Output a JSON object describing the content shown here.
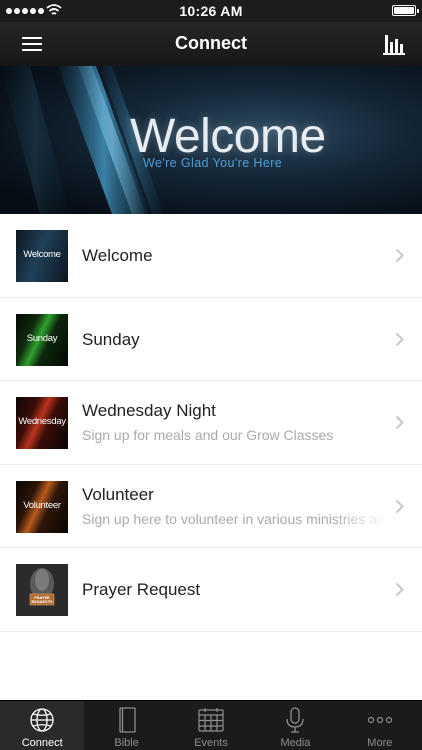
{
  "status_bar": {
    "time": "10:26 AM"
  },
  "nav": {
    "title": "Connect"
  },
  "banner": {
    "title": "Welcome",
    "subtitle": "We're Glad You're Here"
  },
  "items": [
    {
      "thumb_text": "Welcome",
      "title": "Welcome",
      "subtitle": ""
    },
    {
      "thumb_text": "Sunday",
      "title": "Sunday",
      "subtitle": ""
    },
    {
      "thumb_text": "Wednesday",
      "title": "Wednesday Night",
      "subtitle": "Sign up for meals and our Grow Classes"
    },
    {
      "thumb_text": "Volunteer",
      "title": "Volunteer",
      "subtitle": "Sign up here to volunteer in various ministries around"
    },
    {
      "thumb_text": "PRAYER REQUESTS",
      "title": "Prayer Request",
      "subtitle": ""
    }
  ],
  "tabs": [
    {
      "label": "Connect",
      "icon": "globe-icon",
      "active": true
    },
    {
      "label": "Bible",
      "icon": "book-icon",
      "active": false
    },
    {
      "label": "Events",
      "icon": "calendar-icon",
      "active": false
    },
    {
      "label": "Media",
      "icon": "microphone-icon",
      "active": false
    },
    {
      "label": "More",
      "icon": "more-dots-icon",
      "active": false
    }
  ],
  "colors": {
    "bar_background": "#1b1b1b",
    "banner_subtitle": "#4f9fd6",
    "subtitle_text": "#aaaaaa"
  }
}
